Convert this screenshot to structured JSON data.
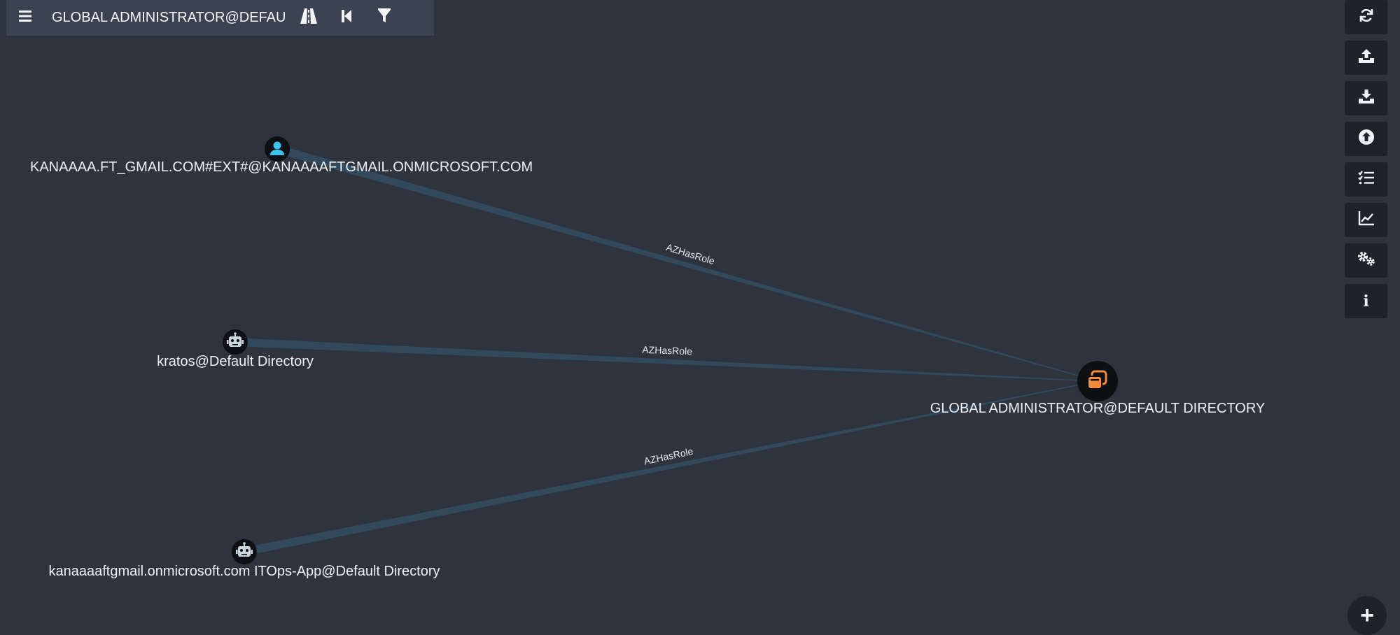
{
  "search": {
    "query": "GLOBAL ADMINISTRATOR@DEFAU"
  },
  "search_icons": [
    "menu-icon",
    "pathfinding-icon",
    "back-icon",
    "filter-icon"
  ],
  "toolbar": {
    "buttons": [
      {
        "name": "refresh-icon"
      },
      {
        "name": "upload-icon"
      },
      {
        "name": "download-icon"
      },
      {
        "name": "import-icon"
      },
      {
        "name": "queries-icon"
      },
      {
        "name": "stats-icon"
      },
      {
        "name": "settings-icon"
      },
      {
        "name": "info-icon",
        "glyph": "i"
      }
    ],
    "zoom_in_glyph": "+"
  },
  "graph": {
    "nodes": [
      {
        "id": "user",
        "type": "user",
        "label": "KANAAAA.FT_GMAIL.COM#EXT#@KANAAAAFTGMAIL.ONMICROSOFT.COM"
      },
      {
        "id": "kratos",
        "type": "service-principal",
        "label": "kratos@Default Directory"
      },
      {
        "id": "itops",
        "type": "service-principal",
        "label": "kanaaaaftgmail.onmicrosoft.com ITOps-App@Default Directory"
      },
      {
        "id": "globaladmin",
        "type": "role",
        "label": "GLOBAL ADMINISTRATOR@DEFAULT DIRECTORY"
      }
    ],
    "edges": [
      {
        "from": "user",
        "to": "globaladmin",
        "label": "AZHasRole"
      },
      {
        "from": "kratos",
        "to": "globaladmin",
        "label": "AZHasRole"
      },
      {
        "from": "itops",
        "to": "globaladmin",
        "label": "AZHasRole"
      }
    ]
  },
  "colors": {
    "background": "#2e343d",
    "edge": "#32495b",
    "user_icon": "#3ac3ef",
    "role_icon": "#f28a3a",
    "service_principal_icon": "#c9d4dc",
    "node_fill": "#0c0f13",
    "toolbar_bg": "#1d222b"
  }
}
